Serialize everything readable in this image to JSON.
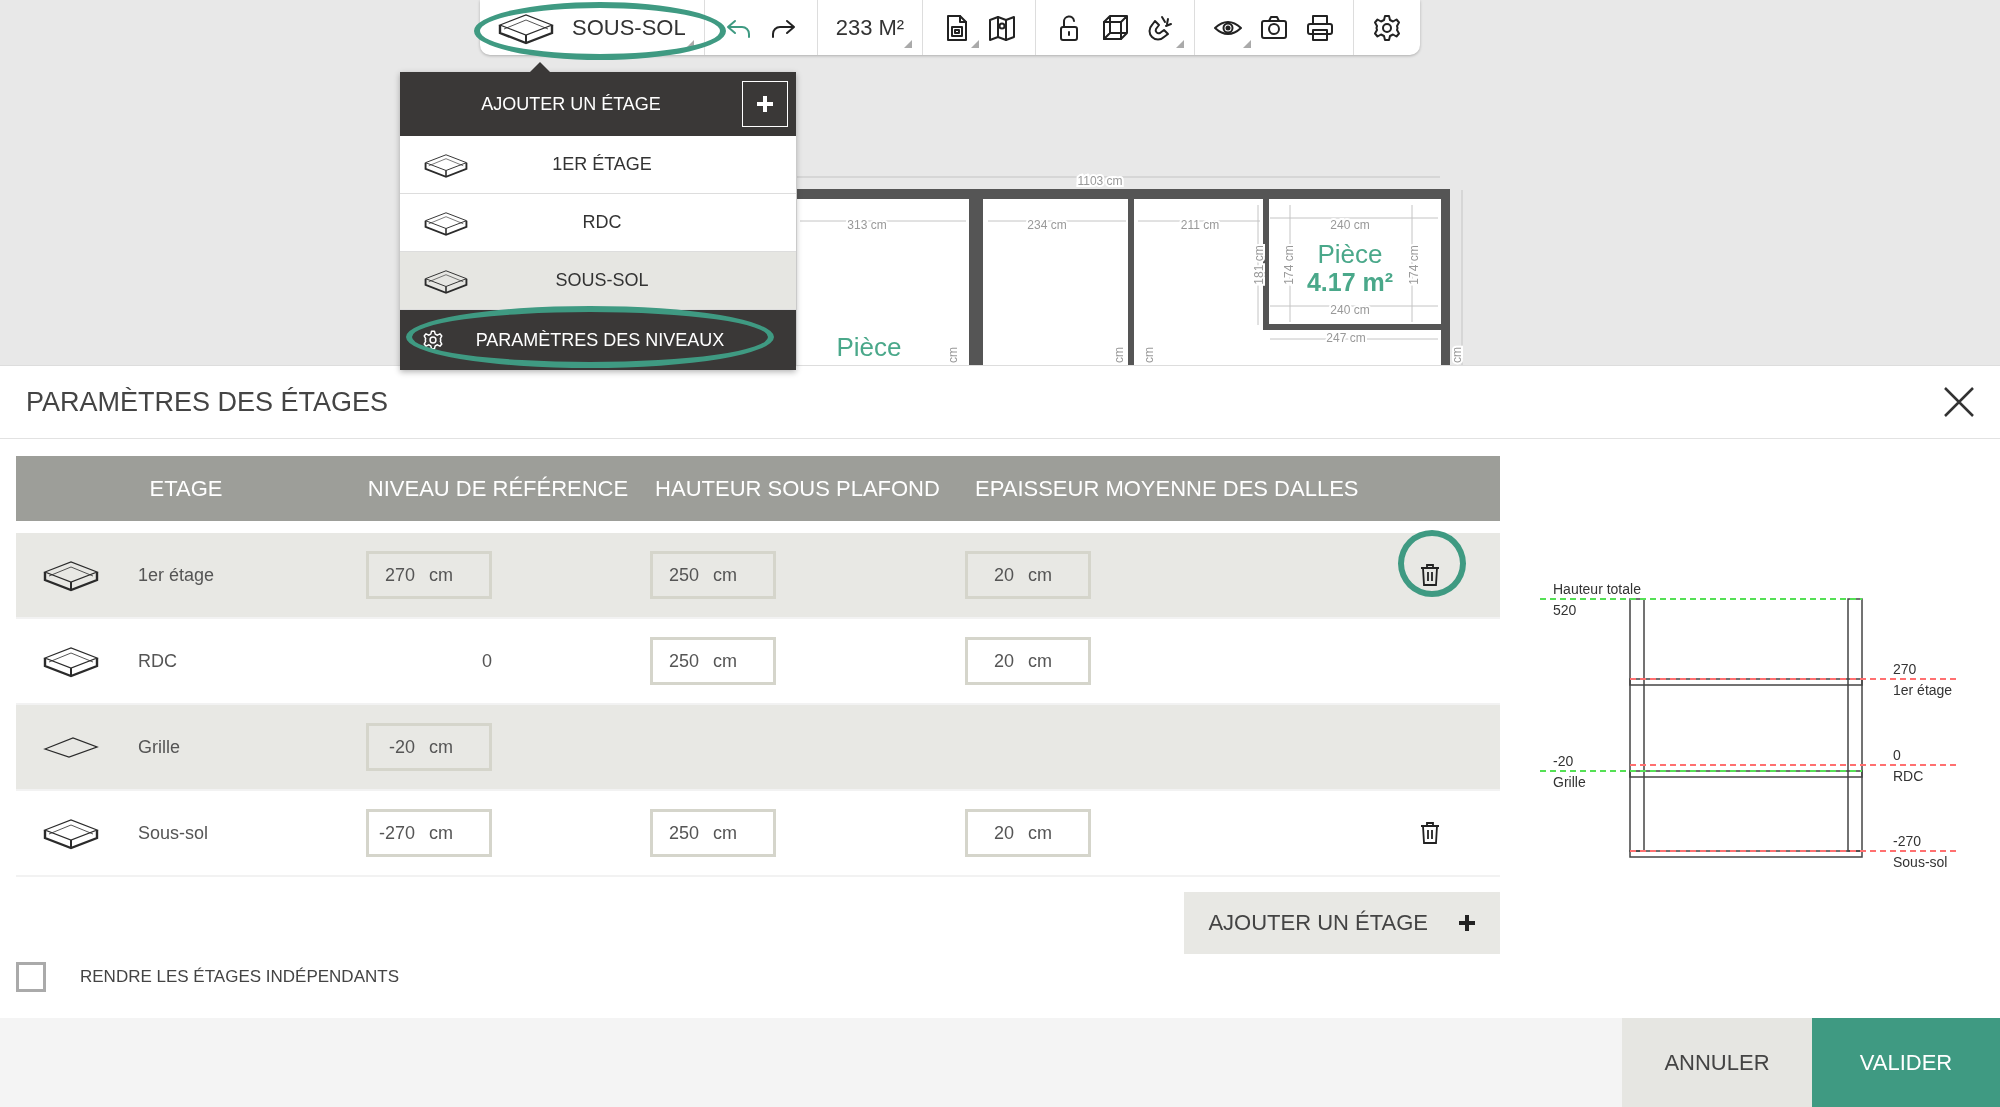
{
  "toolbar": {
    "level_button": {
      "label": "SOUS-SOL",
      "menu": true,
      "highlighted": true
    },
    "groups": [
      [
        {
          "kind": "icon",
          "menu": false
        },
        {
          "kind": "icon",
          "menu": false
        }
      ],
      [
        {
          "kind": "text",
          "label": "233 M²",
          "menu": true
        }
      ],
      [
        {
          "kind": "icon",
          "menu": true
        },
        {
          "kind": "icon",
          "menu": false
        }
      ],
      [
        {
          "kind": "icon",
          "menu": false
        },
        {
          "kind": "icon",
          "menu": false
        },
        {
          "kind": "icon",
          "menu": true
        }
      ],
      [
        {
          "kind": "icon",
          "menu": true
        },
        {
          "kind": "icon",
          "menu": false
        },
        {
          "kind": "icon",
          "menu": false
        }
      ],
      [
        {
          "kind": "icon",
          "menu": false
        }
      ]
    ]
  },
  "level_menu": {
    "title": "AJOUTER UN ÉTAGE",
    "items": [
      {
        "label": "1ER ÉTAGE",
        "selected": false
      },
      {
        "label": "RDC",
        "selected": false
      },
      {
        "label": "SOUS-SOL",
        "selected": true
      }
    ],
    "settings": {
      "label": "PARAMÈTRES DES NIVEAUX",
      "highlighted": true
    }
  },
  "plan": {
    "labels": [
      {
        "text": "1103 cm",
        "kind": "dimension"
      },
      {
        "text": "313 cm",
        "kind": "dimension"
      },
      {
        "text": "234 cm",
        "kind": "dimension"
      },
      {
        "text": "211 cm",
        "kind": "dimension"
      },
      {
        "text": "240 cm",
        "kind": "dimension"
      },
      {
        "text": "181 cm",
        "kind": "dimension"
      },
      {
        "text": "174 cm",
        "kind": "dimension"
      },
      {
        "text": "Pièce",
        "kind": "room"
      },
      {
        "text": "4.17 m²",
        "kind": "area"
      },
      {
        "text": "174 cm",
        "kind": "dimension"
      },
      {
        "text": "240 cm",
        "kind": "dimension"
      },
      {
        "text": "247 cm",
        "kind": "dimension"
      },
      {
        "text": "Pièce",
        "kind": "room"
      },
      {
        "text": "cm",
        "kind": "dimension"
      },
      {
        "text": "cm",
        "kind": "dimension"
      },
      {
        "text": "cm",
        "kind": "dimension"
      },
      {
        "text": "cm",
        "kind": "dimension"
      }
    ]
  },
  "dialog": {
    "title": "PARAMÈTRES DES ÉTAGES",
    "columns": [
      "ETAGE",
      "NIVEAU DE RÉFÉRENCE",
      "HAUTEUR SOUS PLAFOND",
      "EPAISSEUR MOYENNE DES DALLES"
    ],
    "rows": [
      {
        "kind": "floor",
        "name": "1er étage",
        "reference": {
          "value": "270",
          "unit": "cm",
          "editable": true
        },
        "height": {
          "value": "250",
          "unit": "cm"
        },
        "slab": {
          "value": "20",
          "unit": "cm"
        },
        "deletable": true,
        "highlighted": true
      },
      {
        "kind": "floor",
        "name": "RDC",
        "reference": {
          "value": "0",
          "editable": false
        },
        "height": {
          "value": "250",
          "unit": "cm"
        },
        "slab": {
          "value": "20",
          "unit": "cm"
        },
        "deletable": false,
        "highlighted": false
      },
      {
        "kind": "grid",
        "name": "Grille",
        "reference": {
          "value": "-20",
          "unit": "cm",
          "editable": true
        },
        "deletable": false,
        "highlighted": false
      },
      {
        "kind": "floor",
        "name": "Sous-sol",
        "reference": {
          "value": "-270",
          "unit": "cm",
          "editable": true
        },
        "height": {
          "value": "250",
          "unit": "cm"
        },
        "slab": {
          "value": "20",
          "unit": "cm"
        },
        "deletable": true,
        "highlighted": false
      }
    ],
    "add_button": {
      "label": "AJOUTER UN ÉTAGE"
    },
    "independent": {
      "label": "RENDRE LES ÉTAGES INDÉPENDANTS",
      "checked": false
    },
    "diagram": {
      "levels": [
        {
          "above": "Hauteur totale",
          "below": "520",
          "color": "#55e055"
        },
        {
          "above": "270",
          "below": "1er étage",
          "color": "#ff7070"
        },
        {
          "above": "-20",
          "below": "Grille",
          "color": "#55e055"
        },
        {
          "above": "0",
          "below": "RDC",
          "color": "#ff7070"
        },
        {
          "above": "-270",
          "below": "Sous-sol",
          "color": "#ff7070"
        }
      ]
    },
    "buttons": {
      "cancel": "ANNULER",
      "confirm": "VALIDER"
    }
  }
}
